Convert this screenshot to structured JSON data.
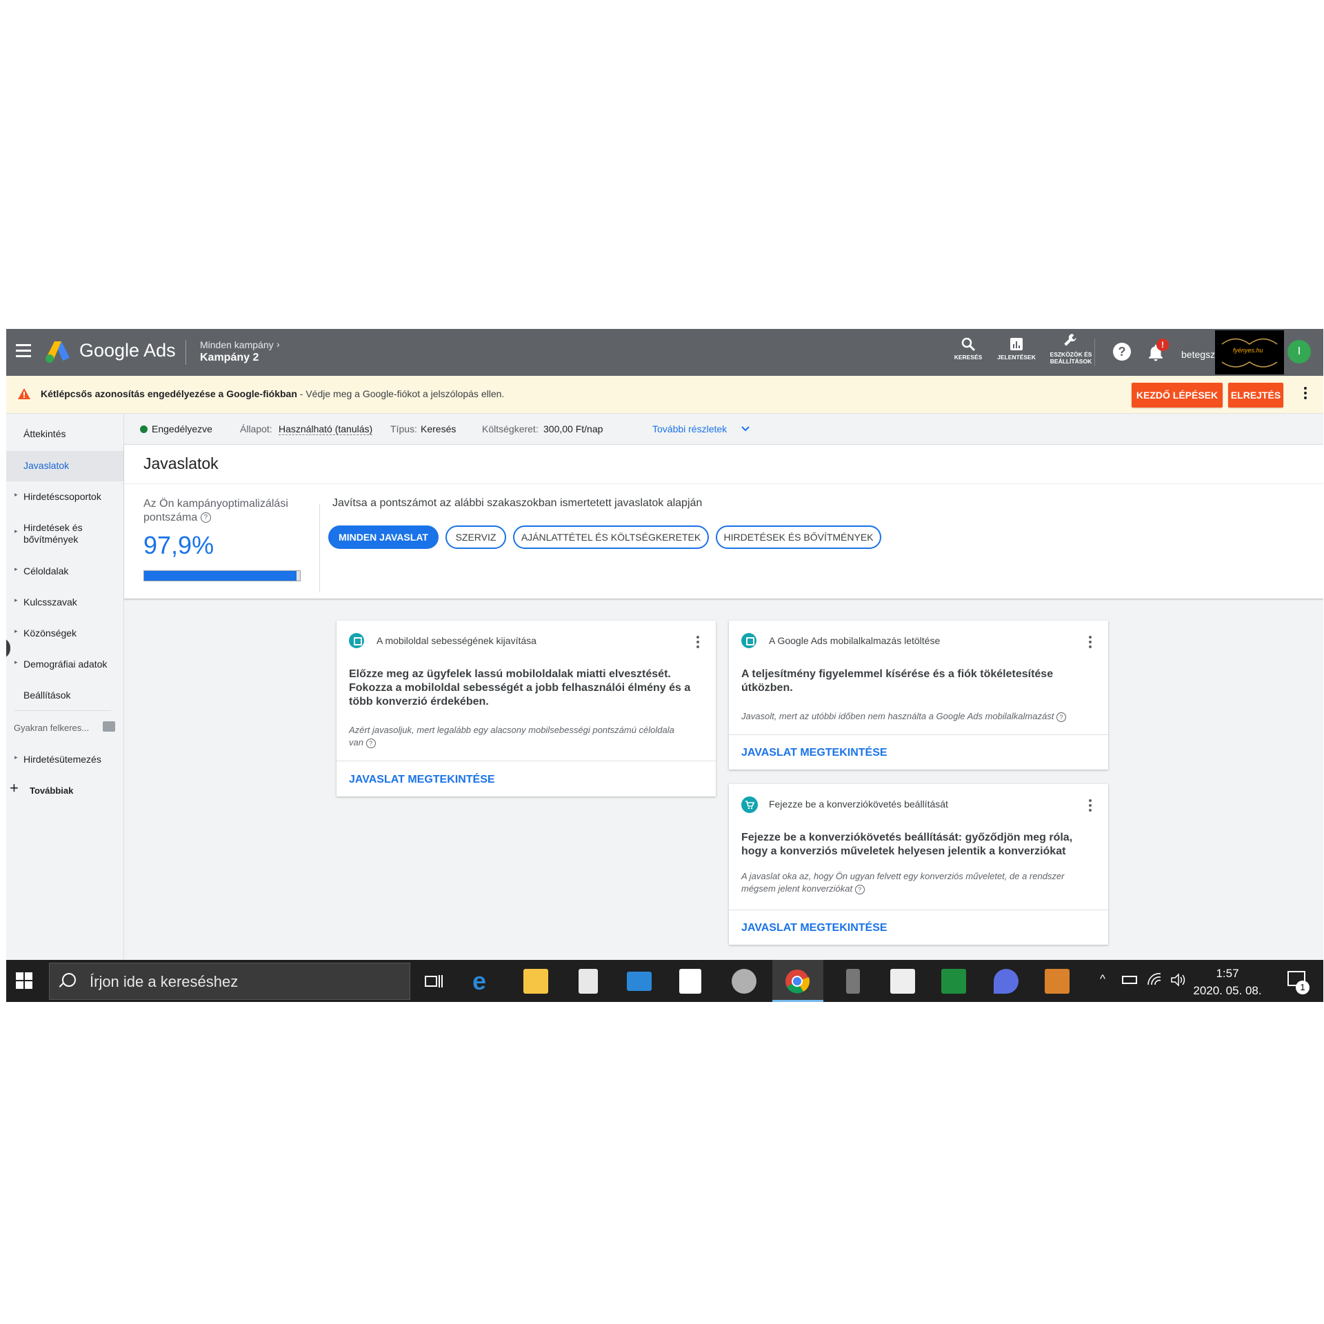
{
  "header": {
    "brand": "Google Ads",
    "breadcrumb_parent": "Minden kampány",
    "breadcrumb_current": "Kampány 2",
    "tools": [
      {
        "label": "KERESÉS"
      },
      {
        "label": "JELENTÉSEK"
      },
      {
        "label": "ESZKÖZÖK ÉS BEÁLLÍTÁSOK"
      }
    ],
    "help_symbol": "?",
    "notification_badge": "!",
    "account_name": "betegsz",
    "account_logo_text": "fyényes.hu",
    "avatar_initial": "I"
  },
  "warning": {
    "bold_text": "Kétlépcsős azonosítás engedélyezése a Google-fiókban",
    "text": " - Védje meg a Google-fiókot a jelszólopás ellen.",
    "primary_button": "KEZDŐ LÉPÉSEK",
    "dismiss_button": "ELREJTÉS"
  },
  "sidebar": {
    "items": [
      {
        "label": "Áttekintés"
      },
      {
        "label": "Javaslatok"
      },
      {
        "label": "Hirdetéscsoportok"
      },
      {
        "label": "Hirdetések és bővítmények"
      },
      {
        "label": "Céloldalak"
      },
      {
        "label": "Kulcsszavak"
      },
      {
        "label": "Közönségek"
      },
      {
        "label": "Demográfiai adatok"
      },
      {
        "label": "Beállítások"
      }
    ],
    "faq_label": "Gyakran felkeres...",
    "schedule_label": "Hirdetésütemezés",
    "more_label": "Továbbiak",
    "plus_symbol": "+"
  },
  "status": {
    "state": "Engedélyezve",
    "status_label": "Állapot:",
    "status_value": "Használható (tanulás)",
    "type_label": "Típus:",
    "type_value": "Keresés",
    "budget_label": "Költségkeret:",
    "budget_value": "300,00 Ft/nap",
    "more_details": "További részletek"
  },
  "recommendations": {
    "title": "Javaslatok",
    "score_label": "Az Ön kampányoptimalizálási pontszáma",
    "score": "97,9%",
    "score_fraction": 0.979,
    "hint": "Javítsa a pontszámot az alábbi szakaszokban ismertetett javaslatok alapján",
    "filters": [
      {
        "label": "MINDEN JAVASLAT"
      },
      {
        "label": "SZERVIZ"
      },
      {
        "label": "AJÁNLATTÉTEL ÉS KÖLTSÉGKERETEK"
      },
      {
        "label": "HIRDETÉSEK ÉS BŐVÍTMÉNYEK"
      }
    ]
  },
  "cards": [
    {
      "title": "A mobiloldal sebességének kijavítása",
      "body_lines": [
        "Előzze meg az ügyfelek lassú mobiloldalak miatti elvesztését.",
        "Fokozza a mobiloldal sebességét a jobb felhasználói élmény és a",
        "több konverzió érdekében."
      ],
      "note_lines": [
        "Azért javasoljuk, mert legalább egy alacsony mobilsebességi pontszámú céloldala",
        "van"
      ],
      "link": "JAVASLAT MEGTEKINTÉSE"
    },
    {
      "title": "A Google Ads mobilalkalmazás letöltése",
      "body_lines": [
        "A teljesítmény figyelemmel kísérése és a fiók tökéletesítése",
        "útközben."
      ],
      "note_lines": [
        "Javasolt, mert az utóbbi időben nem használta a Google Ads mobilalkalmazást"
      ],
      "link": "JAVASLAT MEGTEKINTÉSE"
    },
    {
      "title": "Fejezze be a konverziókövetés beállítását",
      "body_lines": [
        "Fejezze be a konverziókövetés beállítását: győződjön meg róla,",
        "hogy a konverziós műveletek helyesen jelentik a konverziókat"
      ],
      "note_lines": [
        "A javaslat oka az, hogy Ön ugyan felvett egy konverziós műveletet, de a rendszer",
        "mégsem jelent konverziókat"
      ],
      "link": "JAVASLAT MEGTEKINTÉSE"
    }
  ],
  "taskbar": {
    "search_placeholder": "Írjon ide a kereséshez",
    "time": "1:57",
    "date": "2020. 05. 08.",
    "notification_count": "1",
    "tray_up": "^"
  },
  "colors": {
    "accent": "#1a73e8",
    "header_bg": "#5f6368",
    "warning_button": "#f4511e",
    "status_green": "#188038"
  }
}
